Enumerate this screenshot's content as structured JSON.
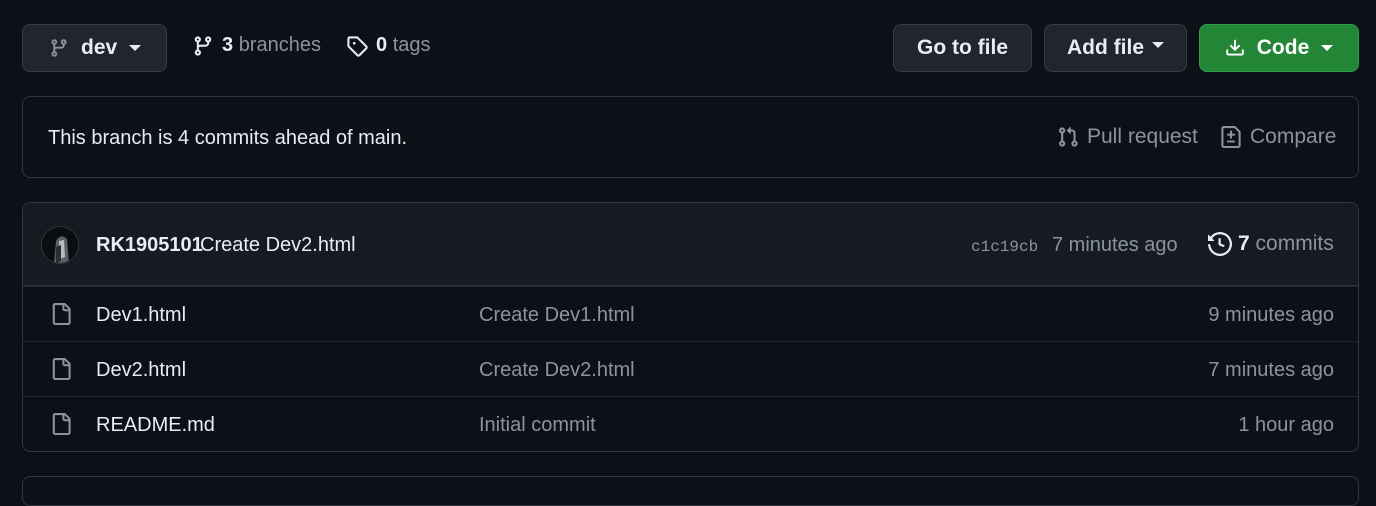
{
  "branch_selector": {
    "label": "dev"
  },
  "branches": {
    "count": "3",
    "label": "branches"
  },
  "tags": {
    "count": "0",
    "label": "tags"
  },
  "buttons": {
    "go_to_file": "Go to file",
    "add_file": "Add file",
    "code": "Code"
  },
  "ahead_banner": {
    "text": "This branch is 4 commits ahead of main.",
    "pull_request": "Pull request",
    "compare": "Compare"
  },
  "latest_commit": {
    "author": "RK1905101",
    "message": "Create Dev2.html",
    "sha": "c1c19cb",
    "time": "7 minutes ago",
    "commits_count": "7",
    "commits_label": "commits"
  },
  "files": [
    {
      "name": "Dev1.html",
      "message": "Create Dev1.html",
      "time": "9 minutes ago",
      "icon": "file-icon"
    },
    {
      "name": "Dev2.html",
      "message": "Create Dev2.html",
      "time": "7 minutes ago",
      "icon": "file-icon"
    },
    {
      "name": "README.md",
      "message": "Initial commit",
      "time": "1 hour ago",
      "icon": "file-icon"
    }
  ],
  "colors": {
    "background": "#0d1117",
    "code_button": "#238636",
    "border": "#30363d",
    "muted_text": "#8b949e"
  }
}
